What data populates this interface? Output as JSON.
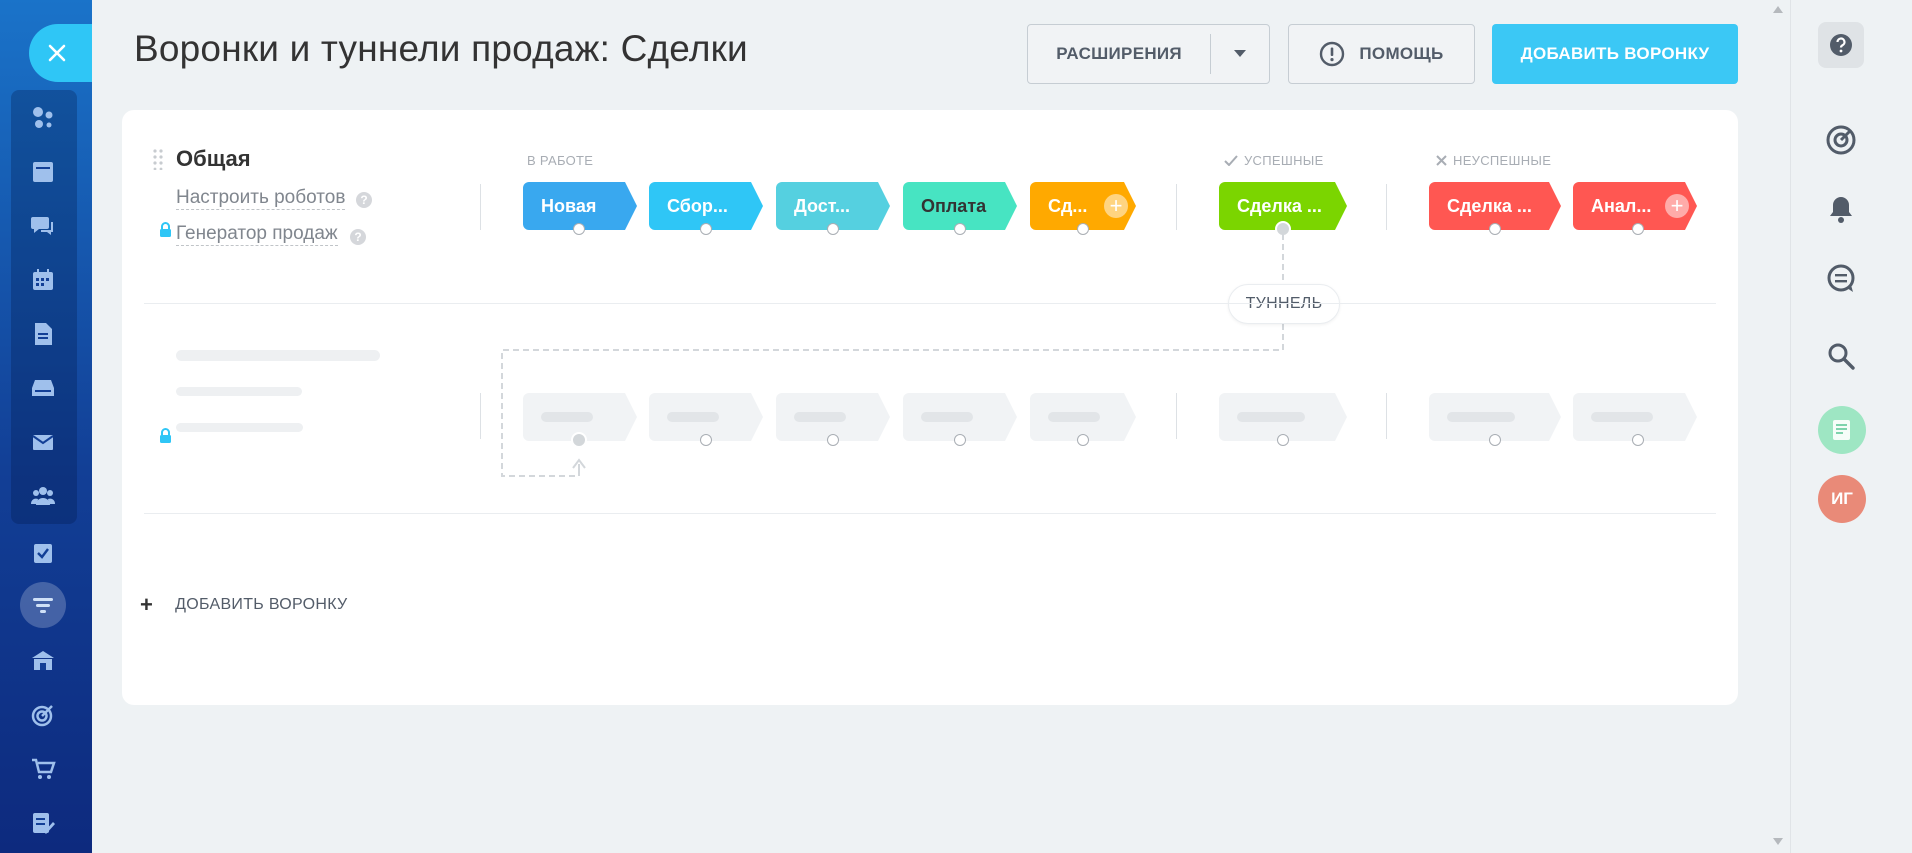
{
  "header": {
    "title": "Воронки и туннели продаж: Сделки",
    "extensions_label": "РАСШИРЕНИЯ",
    "help_label": "ПОМОЩЬ",
    "add_funnel_label": "ДОБАВИТЬ ВОРОНКУ"
  },
  "funnel": {
    "name": "Общая",
    "robots_link": "Настроить роботов",
    "generator_link": "Генератор продаж",
    "groups": {
      "in_work": "В РАБОТЕ",
      "success": "УСПЕШНЫЕ",
      "fail": "НЕУСПЕШНЫЕ"
    },
    "stages": [
      {
        "label": "Новая",
        "color": "#39a8ef"
      },
      {
        "label": "Сбор...",
        "color": "#2fc6f6"
      },
      {
        "label": "Дост...",
        "color": "#55d0e0"
      },
      {
        "label": "Оплата",
        "color": "#47e4c2"
      },
      {
        "label": "Сд...",
        "color": "#ffa900"
      }
    ],
    "success_stage": {
      "label": "Сделка ...",
      "color": "#7bd500"
    },
    "fail_stages": [
      {
        "label": "Сделка ...",
        "color": "#ff5752"
      },
      {
        "label": "Анал...",
        "color": "#ff5752"
      }
    ],
    "tunnel_label": "ТУННЕЛЬ"
  },
  "footer": {
    "add_funnel_plus": "+",
    "add_funnel_label": "ДОБАВИТЬ ВОРОНКУ"
  },
  "user": {
    "initials": "ИГ",
    "avatar_color": "#e98a78"
  },
  "colors": {
    "accent": "#3bc8f5",
    "nav_top": "#1a73c9",
    "nav_bottom": "#0d2a7e"
  }
}
